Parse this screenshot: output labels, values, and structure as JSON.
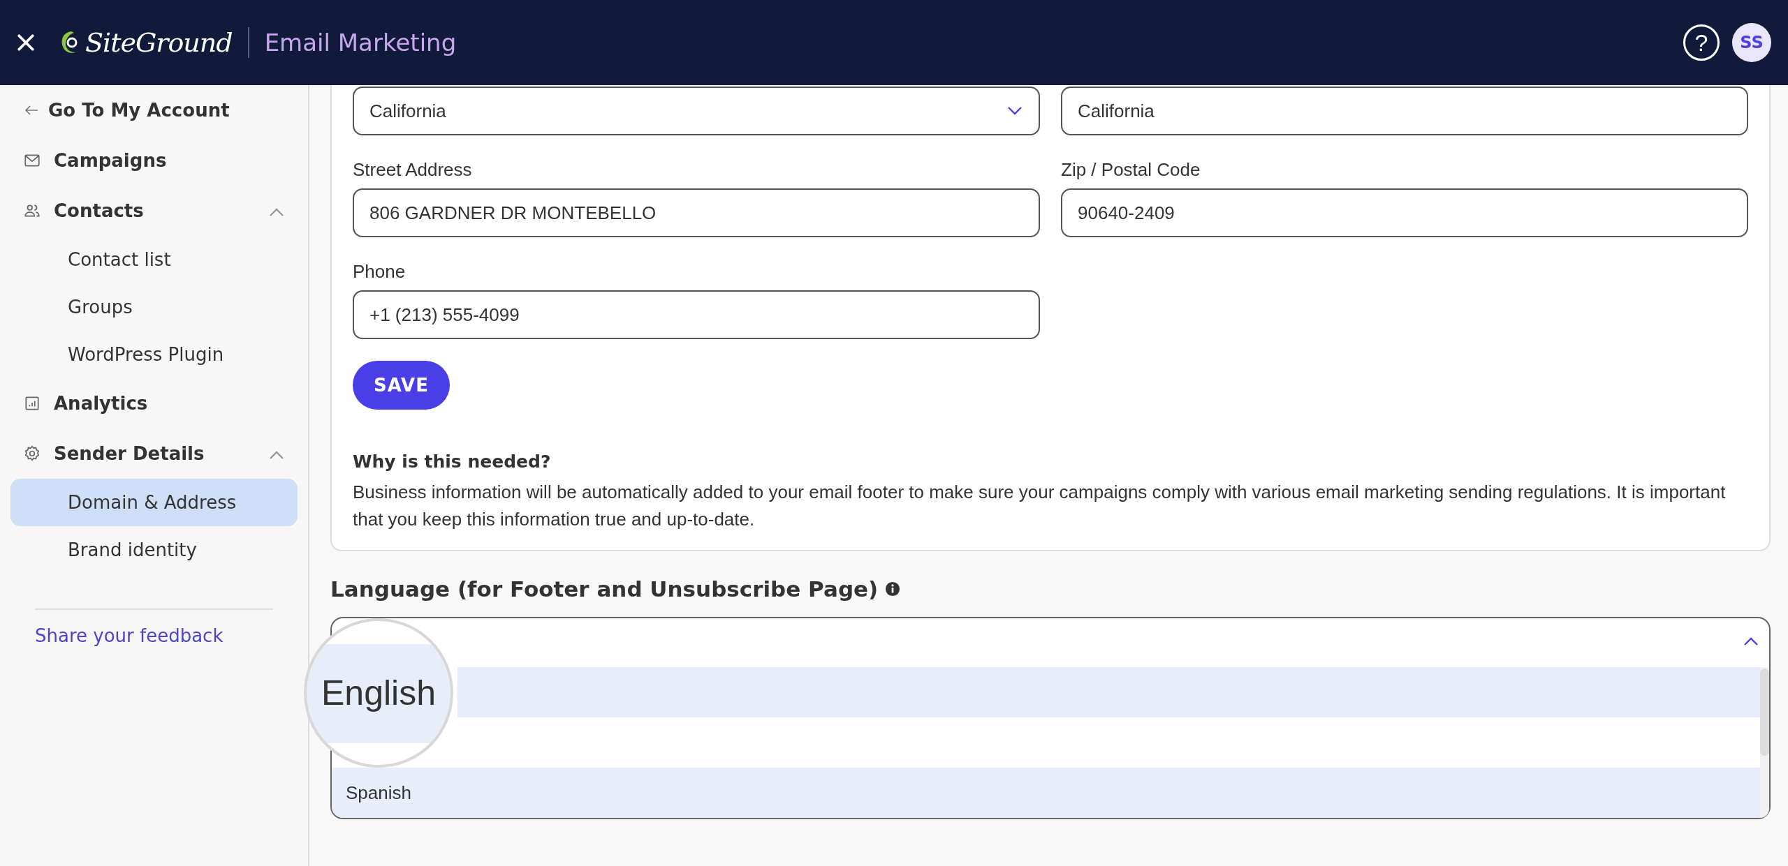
{
  "header": {
    "logo": "SiteGround",
    "product": "Email Marketing",
    "help": "?",
    "avatar": "SS"
  },
  "sidebar": {
    "back": "Go To My Account",
    "items": [
      {
        "label": "Campaigns"
      },
      {
        "label": "Contacts",
        "expanded": true,
        "children": [
          {
            "label": "Contact list",
            "selected": false
          },
          {
            "label": "Groups",
            "selected": false
          },
          {
            "label": "WordPress Plugin",
            "selected": false
          }
        ]
      },
      {
        "label": "Analytics"
      },
      {
        "label": "Sender Details",
        "expanded": true,
        "children": [
          {
            "label": "Domain & Address",
            "selected": true
          },
          {
            "label": "Brand identity",
            "selected": false
          }
        ]
      }
    ],
    "feedback_link": "Share your feedback"
  },
  "form": {
    "fields": [
      {
        "kind": "select",
        "value": "California"
      },
      {
        "kind": "text",
        "value": "California"
      },
      {
        "kind": "text",
        "label": "Street Address",
        "value": "806 GARDNER DR MONTEBELLO"
      },
      {
        "kind": "text",
        "label": "Zip / Postal Code",
        "value": "90640-2409"
      },
      {
        "kind": "text",
        "label": "Phone",
        "value": "+1 (213) 555-4099"
      }
    ],
    "save": "SAVE",
    "note_title": "Why is this needed?",
    "note": "Business information will be automatically added to your email footer to make sure your campaigns comply with various email marketing sending regulations. It is important that you keep this information true and up-to-date."
  },
  "language": {
    "title": "Language (for Footer and Unsubscribe Page)",
    "expanded": true,
    "options": [
      {
        "label": "English",
        "selected": true,
        "magnified": true
      },
      {
        "label": "Spanish",
        "selected": false,
        "hovered": true
      }
    ]
  }
}
